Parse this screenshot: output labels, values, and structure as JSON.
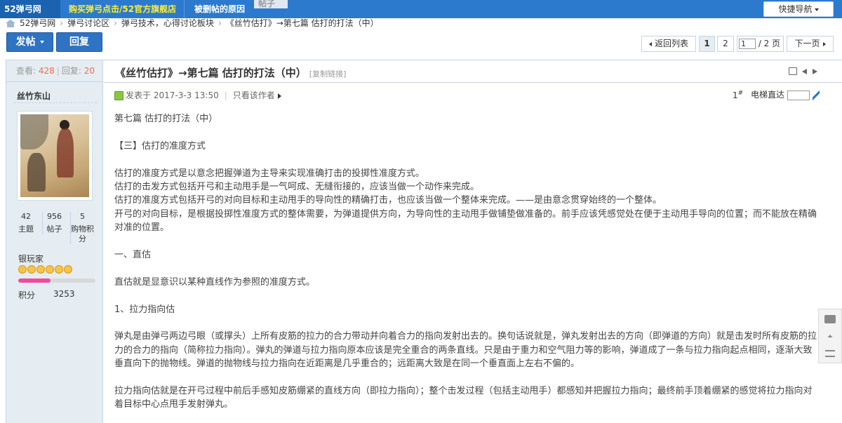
{
  "topnav": {
    "logo": "52弹弓网",
    "shop_link": "购买弹弓点击/52官方旗舰店",
    "deleted_reason": "被删帖的原因",
    "search_hint": "帖子",
    "quick_nav": "快捷导航"
  },
  "breadcrumb": {
    "items": [
      "52弹弓网",
      "弹弓讨论区",
      "弹弓技术，心得讨论板块",
      "《丝竹估打》→第七篇 估打的打法（中）"
    ],
    "separator": "›"
  },
  "actions": {
    "post_label": "发帖",
    "reply_label": "回复"
  },
  "pagination": {
    "back_label": "返回列表",
    "page1": "1",
    "page2": "2",
    "current_input": "1",
    "total_pages": "/ 2 页",
    "next_label": "下一页"
  },
  "thread": {
    "views_label": "查看:",
    "views": "428",
    "replies_label": "回复:",
    "replies": "20",
    "title": "《丝竹估打》→第七篇 估打的打法（中）",
    "copy_link": "[复制链接]"
  },
  "author": {
    "name": "丝竹东山",
    "stats": [
      {
        "value": "42",
        "label": "主题"
      },
      {
        "value": "956",
        "label": "帖子"
      },
      {
        "value": "5",
        "label": "购物积分"
      }
    ],
    "rank": "银玩家",
    "star_count": 6,
    "progress_fraction": 0.42,
    "points_label": "积分",
    "points": "3253"
  },
  "post": {
    "posted_prefix": "发表于",
    "posted_time": "2017-3-3 13:50",
    "author_only": "只看该作者",
    "floor_number": "1",
    "floor_mark": "#",
    "elevator_label": "电梯直达",
    "paragraphs": [
      "第七篇 估打的打法（中）",
      "",
      "【三】估打的准度方式",
      "",
      "估打的准度方式是以意念把握弹道为主导来实现准确打击的投掷性准度方式。",
      "估打的击发方式包括开弓和主动甩手是一气呵成、无缝衔接的，应该当做一个动作来完成。",
      "估打的准度方式包括开弓的对向目标和主动甩手的导向性的精确打击，也应该当做一个整体来完成。——是由意念贯穿始终的一个整体。",
      "开弓的对向目标，是根据投掷性准度方式的整体需要，为弹道提供方向，为导向性的主动甩手做铺垫做准备的。前手应该凭感觉处在便于主动甩手导向的位置；而不能放在精确对准的位置。",
      "",
      "一、直估",
      "",
      "直估就是显意识以某种直线作为参照的准度方式。",
      "",
      "1、拉力指向估",
      "",
      "弹丸是由弹弓两边弓眼（或撑头）上所有皮筋的拉力的合力带动并向着合力的指向发射出去的。换句话说就是，弹丸发射出去的方向（即弹道的方向）就是击发时所有皮筋的拉力的合力的指向（简称拉力指向）。弹丸的弹道与拉力指向原本应该是完全重合的两条直线。只是由于重力和空气阻力等的影响，弹道成了一条与拉力指向起点相同，逐渐大致垂直向下的抛物线。弹道的抛物线与拉力指向在近距离是几乎重合的；远距离大致是在同一个垂直面上左右不偏的。",
      "",
      "拉力指向估就是在开弓过程中前后手感知皮筋绷紧的直线方向（即拉力指向）；整个击发过程（包括主动甩手）都感知并把握拉力指向；最终前手顶着绷紧的感觉将拉力指向对着目标中心点甩手发射弹丸。"
    ]
  }
}
